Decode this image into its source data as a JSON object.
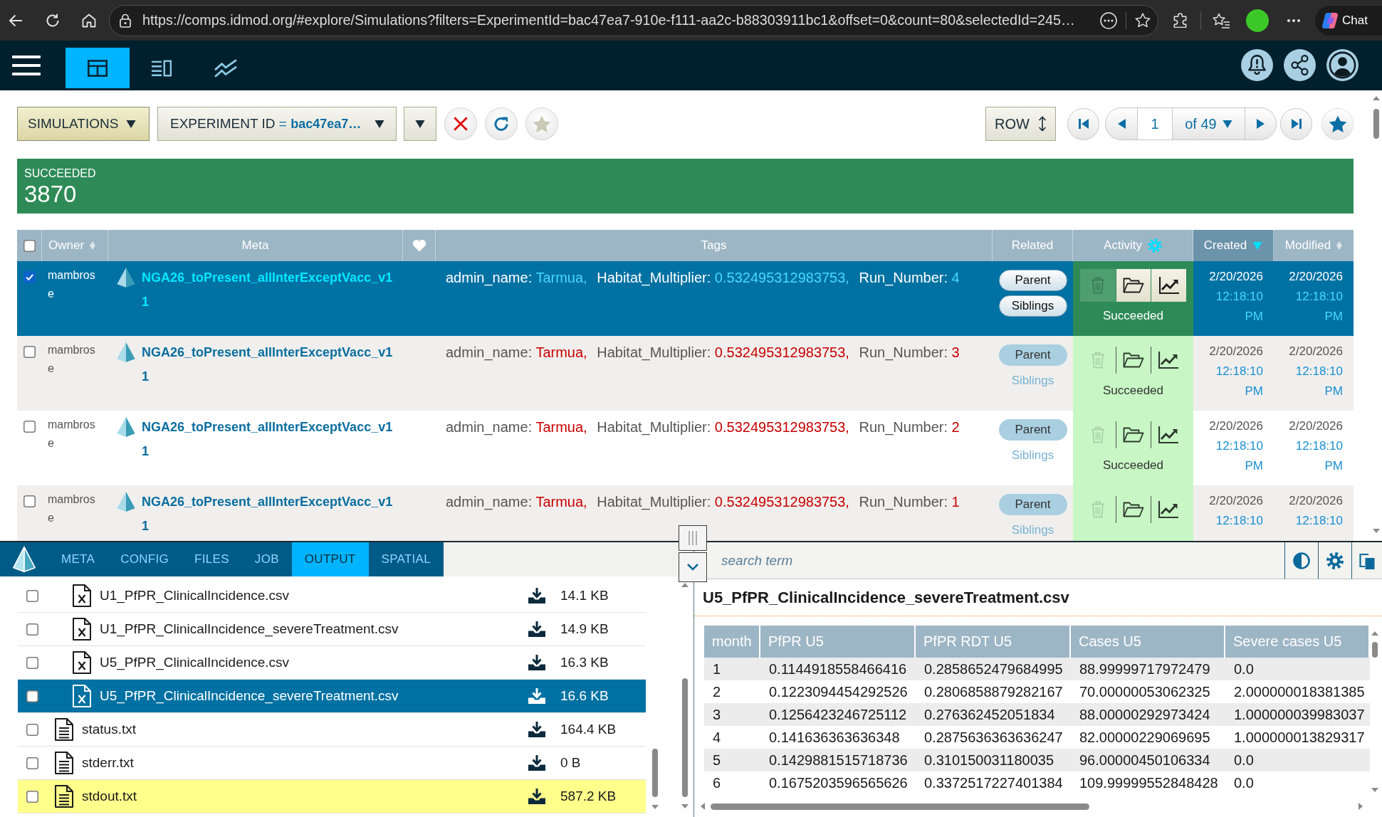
{
  "browser": {
    "url": "https://comps.idmod.org/#explore/Simulations?filters=ExperimentId=bac47ea7-910e-f111-aa2c-b88303911bc1&offset=0&count=80&selectedId=245…",
    "chat_button": "Chat"
  },
  "app_nav": {
    "views": [
      {
        "kind": "grid",
        "selected": true
      },
      {
        "kind": "list",
        "selected": false
      },
      {
        "kind": "chart",
        "selected": false
      }
    ]
  },
  "toolbar": {
    "entity": "SIMULATIONS",
    "filter": {
      "field": "EXPERIMENT ID",
      "operator": "=",
      "value": "bac47ea7…"
    },
    "row_mode": "ROW",
    "pager": {
      "page": "1",
      "total": "of 49"
    }
  },
  "summary": {
    "label": "SUCCEEDED",
    "count": "3870"
  },
  "table": {
    "select_all": {
      "checked": false
    },
    "columns": [
      {
        "kind": "label",
        "label": "Owner",
        "sortable": true,
        "sorted": false
      },
      {
        "kind": "label",
        "label": "Meta"
      },
      {
        "kind": "favorite"
      },
      {
        "kind": "label",
        "label": "Tags"
      },
      {
        "kind": "label",
        "label": "Related"
      },
      {
        "kind": "label",
        "label": "Activity",
        "settings": true
      },
      {
        "kind": "label",
        "label": "Created",
        "sortable": true,
        "sorted": true
      },
      {
        "kind": "label",
        "label": "Modified",
        "sortable": true,
        "sorted": false
      }
    ],
    "rows": [
      {
        "selected": true,
        "checked": true,
        "owner": "mambrose",
        "name": "NGA26_toPresent_allInterExceptVacc_v11",
        "tags": [
          {
            "key": "admin_name:",
            "value": "Tarmua,"
          },
          {
            "key": "Habitat_Multiplier:",
            "value": "0.532495312983753,"
          },
          {
            "key": "Run_Number:",
            "value": "4"
          }
        ],
        "related": [
          {
            "label": "Parent",
            "kind": "button"
          },
          {
            "label": "Siblings",
            "kind": "button"
          }
        ],
        "actions": [
          {
            "kind": "delete",
            "disabled": true
          },
          {
            "kind": "files",
            "disabled": false
          },
          {
            "kind": "plot",
            "disabled": false
          }
        ],
        "status": "Succeeded",
        "created": {
          "date": "2/20/2026",
          "time": "12:18:10 PM"
        },
        "modified": {
          "date": "2/20/2026",
          "time": "12:18:10 PM"
        }
      },
      {
        "selected": false,
        "checked": false,
        "owner": "mambrose",
        "name": "NGA26_toPresent_allInterExceptVacc_v11",
        "tags": [
          {
            "key": "admin_name:",
            "value": "Tarmua,"
          },
          {
            "key": "Habitat_Multiplier:",
            "value": "0.532495312983753,"
          },
          {
            "key": "Run_Number:",
            "value": "3"
          }
        ],
        "related": [
          {
            "label": "Parent",
            "kind": "button"
          },
          {
            "label": "Siblings",
            "kind": "link"
          }
        ],
        "actions": [
          {
            "kind": "delete",
            "disabled": true
          },
          {
            "kind": "files",
            "disabled": false
          },
          {
            "kind": "plot",
            "disabled": false
          }
        ],
        "status": "Succeeded",
        "created": {
          "date": "2/20/2026",
          "time": "12:18:10 PM"
        },
        "modified": {
          "date": "2/20/2026",
          "time": "12:18:10 PM"
        }
      },
      {
        "selected": false,
        "checked": false,
        "owner": "mambrose",
        "name": "NGA26_toPresent_allInterExceptVacc_v11",
        "tags": [
          {
            "key": "admin_name:",
            "value": "Tarmua,"
          },
          {
            "key": "Habitat_Multiplier:",
            "value": "0.532495312983753,"
          },
          {
            "key": "Run_Number:",
            "value": "2"
          }
        ],
        "related": [
          {
            "label": "Parent",
            "kind": "button"
          },
          {
            "label": "Siblings",
            "kind": "link"
          }
        ],
        "actions": [
          {
            "kind": "delete",
            "disabled": true
          },
          {
            "kind": "files",
            "disabled": false
          },
          {
            "kind": "plot",
            "disabled": false
          }
        ],
        "status": "Succeeded",
        "created": {
          "date": "2/20/2026",
          "time": "12:18:10 PM"
        },
        "modified": {
          "date": "2/20/2026",
          "time": "12:18:10 PM"
        }
      },
      {
        "selected": false,
        "checked": false,
        "owner": "mambrose",
        "name": "NGA26_toPresent_allInterExceptVacc_v11",
        "tags": [
          {
            "key": "admin_name:",
            "value": "Tarmua,"
          },
          {
            "key": "Habitat_Multiplier:",
            "value": "0.532495312983753,"
          },
          {
            "key": "Run_Number:",
            "value": "1"
          }
        ],
        "related": [
          {
            "label": "Parent",
            "kind": "button"
          },
          {
            "label": "Siblings",
            "kind": "link"
          }
        ],
        "actions": [
          {
            "kind": "delete",
            "disabled": true
          },
          {
            "kind": "files",
            "disabled": false
          },
          {
            "kind": "plot",
            "disabled": false
          }
        ],
        "created": {
          "date": "2/20/2026",
          "time": "12:18:10"
        },
        "modified": {
          "date": "2/20/2026",
          "time": "12:18:10"
        }
      }
    ]
  },
  "detail": {
    "tabs": [
      {
        "label": "META",
        "selected": false
      },
      {
        "label": "CONFIG",
        "selected": false
      },
      {
        "label": "FILES",
        "selected": false
      },
      {
        "label": "JOB",
        "selected": false
      },
      {
        "label": "OUTPUT",
        "selected": true
      },
      {
        "label": "SPATIAL",
        "selected": false
      }
    ],
    "files": [
      {
        "children": [
          {
            "kind": "csv",
            "name": "U1_PfPR_ClinicalIncidence.csv",
            "size": "14.1 KB",
            "checked": false,
            "selected": false,
            "highlighted": false
          },
          {
            "kind": "csv",
            "name": "U1_PfPR_ClinicalIncidence_severeTreatment.csv",
            "size": "14.9 KB",
            "checked": false,
            "selected": false,
            "highlighted": false
          },
          {
            "kind": "csv",
            "name": "U5_PfPR_ClinicalIncidence.csv",
            "size": "16.3 KB",
            "checked": false,
            "selected": false,
            "highlighted": false
          },
          {
            "kind": "csv",
            "name": "U5_PfPR_ClinicalIncidence_severeTreatment.csv",
            "size": "16.6 KB",
            "checked": false,
            "selected": true,
            "highlighted": false
          }
        ]
      },
      {
        "kind": "txt",
        "name": "status.txt",
        "size": "164.4 KB",
        "checked": false,
        "selected": false,
        "highlighted": false
      },
      {
        "kind": "txt",
        "name": "stderr.txt",
        "size": "0 B",
        "checked": false,
        "selected": false,
        "highlighted": false
      },
      {
        "kind": "txt",
        "name": "stdout.txt",
        "size": "587.2 KB",
        "checked": false,
        "selected": false,
        "highlighted": true
      }
    ],
    "viewer": {
      "search": {
        "placeholder": "search term"
      },
      "title": "U5_PfPR_ClinicalIncidence_severeTreatment.csv",
      "columns": [
        "month",
        "PfPR U5",
        "PfPR RDT U5",
        "Cases U5",
        "Severe cases U5"
      ],
      "rows": [
        [
          "1",
          "0.1144918558466416",
          "0.2858652479684995",
          "88.99999717972479",
          "0.0"
        ],
        [
          "2",
          "0.1223094454292526",
          "0.2806858879282167",
          "70.00000053062325",
          "2.000000018381385"
        ],
        [
          "3",
          "0.1256423246725112",
          "0.276362452051834",
          "88.00000292973424",
          "1.000000039983037"
        ],
        [
          "4",
          "0.141636363636348",
          "0.2875636363636247",
          "82.00000229069695",
          "1.000000013829317"
        ],
        [
          "5",
          "0.1429881515718736",
          "0.310150031180035",
          "96.00000450106334",
          "0.0"
        ],
        [
          "6",
          "0.1675203596565626",
          "0.3372517227401384",
          "109.99999552848428",
          "0.0"
        ]
      ]
    }
  }
}
